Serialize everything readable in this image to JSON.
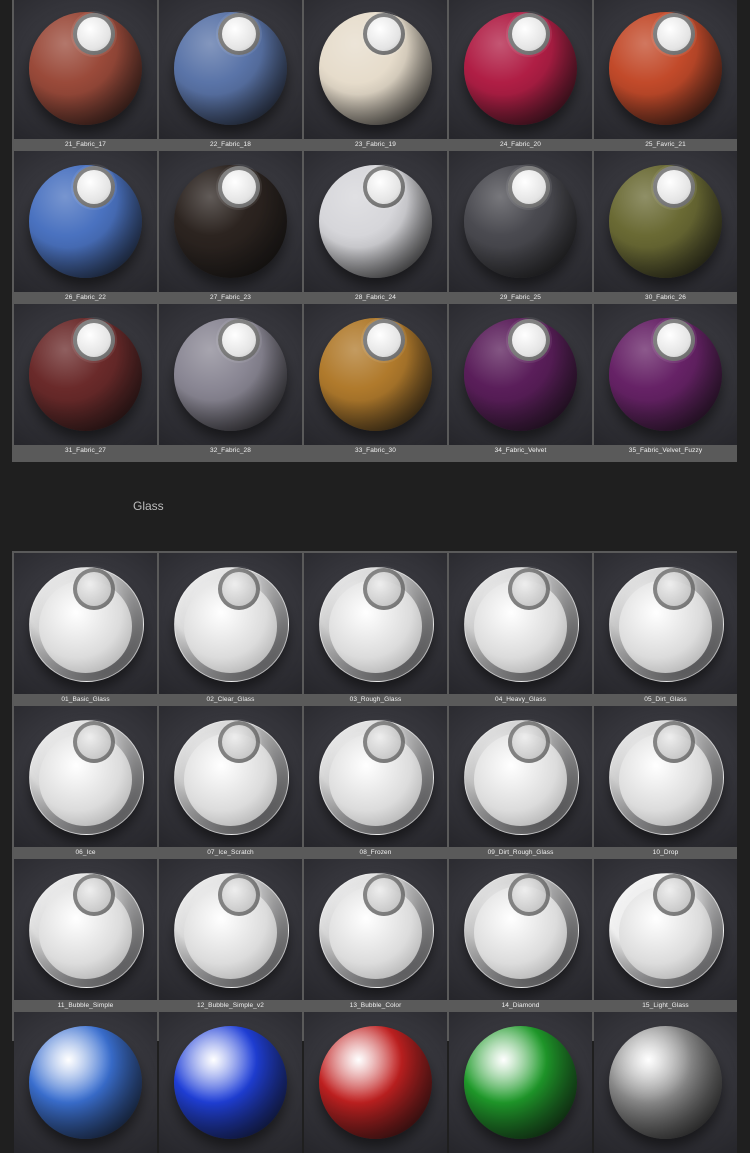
{
  "fabric": {
    "items": [
      {
        "label": "21_Fabric_17",
        "color": "#9a4a3a"
      },
      {
        "label": "22_Fabric_18",
        "color": "#5a74a8"
      },
      {
        "label": "23_Fabric_19",
        "color": "#e6dccb"
      },
      {
        "label": "24_Fabric_20",
        "color": "#b01e45"
      },
      {
        "label": "25_Favric_21",
        "color": "#c24a2a"
      },
      {
        "label": "26_Fabric_22",
        "color": "#4a72c0"
      },
      {
        "label": "27_Fabric_23",
        "color": "#2c2420"
      },
      {
        "label": "28_Fabric_24",
        "color": "#d6d6da"
      },
      {
        "label": "29_Fabric_25",
        "color": "#4a4a50"
      },
      {
        "label": "30_Fabric_26",
        "color": "#6a6a34"
      },
      {
        "label": "31_Fabric_27",
        "color": "#6a2a2a"
      },
      {
        "label": "32_Fabric_28",
        "color": "#8a8794"
      },
      {
        "label": "33_Fabric_30",
        "color": "#b07a2c"
      },
      {
        "label": "34_Fabric_Velvet",
        "color": "#5a1e5a"
      },
      {
        "label": "35_Fabric_Velvet_Fuzzy",
        "color": "#662266"
      }
    ]
  },
  "glass_section": {
    "title": "Glass",
    "items": [
      {
        "label": "01_Basic_Glass",
        "color": "#cfcfcf"
      },
      {
        "label": "02_Clear_Glass",
        "color": "#d8d8d8"
      },
      {
        "label": "03_Rough_Glass",
        "color": "#c8c8c8"
      },
      {
        "label": "04_Heavy_Glass",
        "color": "#cacaca"
      },
      {
        "label": "05_Dirt_Glass",
        "color": "#c0c0c0"
      },
      {
        "label": "06_Ice",
        "color": "#d4d4d4"
      },
      {
        "label": "07_Ice_Scratch",
        "color": "#c4c4c4"
      },
      {
        "label": "08_Frozen",
        "color": "#d0d0d0"
      },
      {
        "label": "09_Dirt_Rough_Glass",
        "color": "#bcbcbc"
      },
      {
        "label": "10_Drop",
        "color": "#c8c8c8"
      },
      {
        "label": "11_Bubble_Simple",
        "color": "#d8d8d8"
      },
      {
        "label": "12_Bubble_Simple_v2",
        "color": "#d8d8d8"
      },
      {
        "label": "13_Bubble_Color",
        "color": "#d2d2d2"
      },
      {
        "label": "14_Diamond",
        "color": "#bdbdbd"
      },
      {
        "label": "15_Light_Glass",
        "color": "#eeeeee"
      }
    ],
    "peek_colors": [
      "#3a6fd0",
      "#1f3fd8",
      "#c02020",
      "#1f9a2a",
      "#8a8a8a"
    ]
  }
}
